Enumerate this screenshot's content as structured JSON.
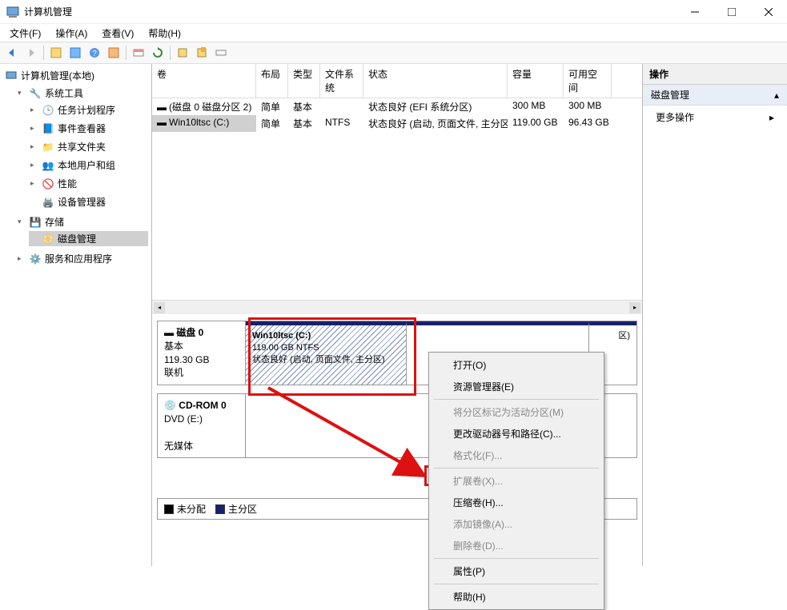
{
  "window": {
    "title": "计算机管理"
  },
  "menubar": [
    "文件(F)",
    "操作(A)",
    "查看(V)",
    "帮助(H)"
  ],
  "tree": {
    "root": "计算机管理(本地)",
    "system_tools": "系统工具",
    "task_scheduler": "任务计划程序",
    "event_viewer": "事件查看器",
    "shared_folders": "共享文件夹",
    "local_users": "本地用户和组",
    "performance": "性能",
    "device_manager": "设备管理器",
    "storage": "存储",
    "disk_mgmt": "磁盘管理",
    "services_apps": "服务和应用程序"
  },
  "columns": {
    "volume": "卷",
    "layout": "布局",
    "type": "类型",
    "fs": "文件系统",
    "status": "状态",
    "capacity": "容量",
    "free": "可用空间"
  },
  "volumes": [
    {
      "name": "(磁盘 0 磁盘分区 2)",
      "layout": "简单",
      "type": "基本",
      "fs": "",
      "status": "状态良好 (EFI 系统分区)",
      "capacity": "300 MB",
      "free": "300 MB"
    },
    {
      "name": "Win10ltsc (C:)",
      "layout": "简单",
      "type": "基本",
      "fs": "NTFS",
      "status": "状态良好 (启动, 页面文件, 主分区)",
      "capacity": "119.00 GB",
      "free": "96.43 GB"
    }
  ],
  "disk0": {
    "title": "磁盘 0",
    "type": "基本",
    "size": "119.30 GB",
    "state": "联机",
    "p1_name": "Win10ltsc  (C:)",
    "p1_size": "119.00 GB NTFS",
    "p1_status": "状态良好 (启动, 页面文件, 主分区)",
    "p2_suffix": "区)"
  },
  "cdrom": {
    "title": "CD-ROM 0",
    "type": "DVD (E:)",
    "state": "无媒体"
  },
  "legend": {
    "unallocated": "未分配",
    "primary": "主分区"
  },
  "actions": {
    "header": "操作",
    "disk_mgmt": "磁盘管理",
    "more": "更多操作"
  },
  "context": {
    "open": "打开(O)",
    "explorer": "资源管理器(E)",
    "mark_active": "将分区标记为活动分区(M)",
    "change_letter": "更改驱动器号和路径(C)...",
    "format": "格式化(F)...",
    "extend": "扩展卷(X)...",
    "shrink": "压缩卷(H)...",
    "add_mirror": "添加镜像(A)...",
    "delete": "删除卷(D)...",
    "properties": "属性(P)",
    "help": "帮助(H)"
  }
}
